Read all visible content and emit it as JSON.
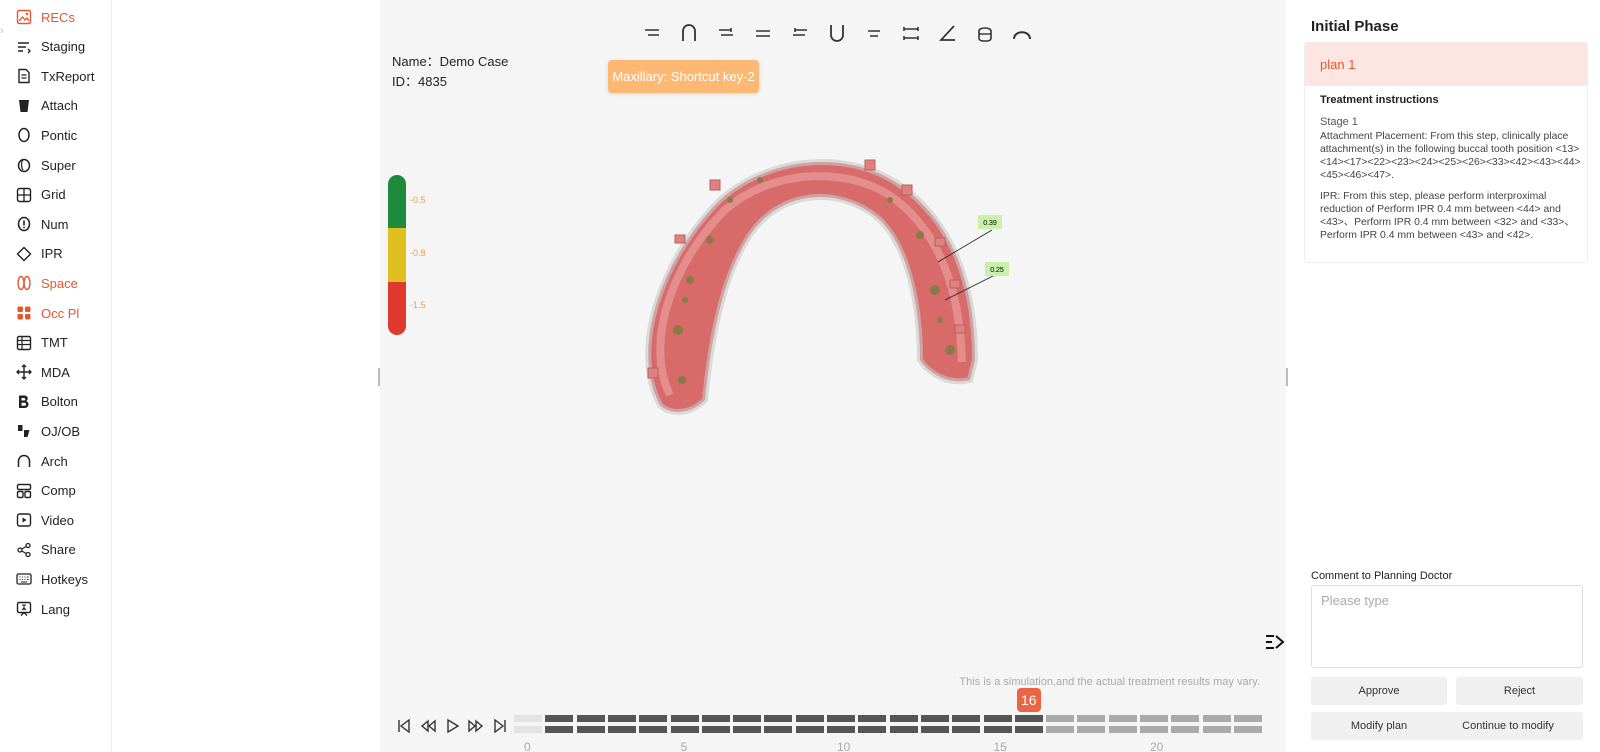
{
  "sidebar": {
    "items": [
      {
        "label": "RECs",
        "icon": "image-icon",
        "active": true
      },
      {
        "label": "Staging",
        "icon": "staging-icon",
        "active": false
      },
      {
        "label": "TxReport",
        "icon": "report-icon",
        "active": false
      },
      {
        "label": "Attach",
        "icon": "attach-icon",
        "active": false
      },
      {
        "label": "Pontic",
        "icon": "pontic-icon",
        "active": false
      },
      {
        "label": "Super",
        "icon": "super-icon",
        "active": false
      },
      {
        "label": "Grid",
        "icon": "grid-icon",
        "active": false
      },
      {
        "label": "Num",
        "icon": "num-icon",
        "active": false
      },
      {
        "label": "IPR",
        "icon": "diamond-icon",
        "active": false
      },
      {
        "label": "Space",
        "icon": "space-icon",
        "active": true
      },
      {
        "label": "Occ Pl",
        "icon": "occ-icon",
        "active": true
      },
      {
        "label": "TMT",
        "icon": "table-icon",
        "active": false
      },
      {
        "label": "MDA",
        "icon": "move-icon",
        "active": false
      },
      {
        "label": "Bolton",
        "icon": "bolton-icon",
        "active": false
      },
      {
        "label": "OJ/OB",
        "icon": "ojob-icon",
        "active": false
      },
      {
        "label": "Arch",
        "icon": "arch-icon",
        "active": false
      },
      {
        "label": "Comp",
        "icon": "compare-icon",
        "active": false
      },
      {
        "label": "Video",
        "icon": "video-icon",
        "active": false
      },
      {
        "label": "Share",
        "icon": "share-icon",
        "active": false
      },
      {
        "label": "Hotkeys",
        "icon": "keyboard-icon",
        "active": false
      },
      {
        "label": "Lang",
        "icon": "language-icon",
        "active": false
      }
    ]
  },
  "case": {
    "name": "Name：Demo Case",
    "id": "ID：4835"
  },
  "tooltip": "Maxillary: Shortcut key-2",
  "scale": {
    "labels": [
      "-0.5",
      "-0.8",
      "-1.5"
    ],
    "colors": [
      "#1e8a3c",
      "#e0c020",
      "#e03a2e"
    ]
  },
  "ipr_labels": [
    "0.39",
    "0.25"
  ],
  "disclaimer": "This is a simulation,and the actual treatment results may vary.",
  "timeline": {
    "stage_count": 24,
    "current_stage": "16",
    "current_index": 16,
    "ticks": [
      "0",
      "5",
      "10",
      "15",
      "20"
    ]
  },
  "panel": {
    "phase_title": "Initial Phase",
    "plan_name": "plan 1",
    "instructions_title": "Treatment instructions",
    "stage_label": "Stage 1",
    "attachment_text": "Attachment Placement: From this step, clinically place attachment(s) in the following buccal tooth position <13><14><17><22><23><24><25><26><33><42><43><44><45><46><47>.",
    "ipr_text": "IPR: From this step, please perform interproximal reduction of Perform IPR 0.4 mm between <44> and <43>、Perform IPR 0.4 mm between <32> and <33>、Perform IPR 0.4 mm between <43> and <42>.",
    "comment_label": "Comment to Planning Doctor",
    "comment_placeholder": "Please type",
    "buttons": {
      "approve": "Approve",
      "reject": "Reject",
      "modify": "Modify plan",
      "continue": "Continue to modify"
    }
  }
}
